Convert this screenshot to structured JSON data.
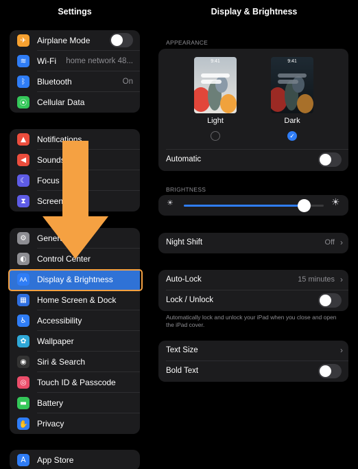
{
  "left": {
    "title": "Settings",
    "group1": [
      {
        "label": "Airplane Mode",
        "icon": "airplane-icon",
        "color": "#f7a130"
      },
      {
        "label": "Wi-Fi",
        "value": "home network 48...",
        "icon": "wifi-icon",
        "color": "#2f7df6"
      },
      {
        "label": "Bluetooth",
        "value": "On",
        "icon": "bluetooth-icon",
        "color": "#2f7df6"
      },
      {
        "label": "Cellular Data",
        "icon": "cellular-icon",
        "color": "#34c759"
      }
    ],
    "group2": [
      {
        "label": "Notifications",
        "icon": "notifications-icon",
        "color": "#eb4d3d"
      },
      {
        "label": "Sounds",
        "icon": "sounds-icon",
        "color": "#eb4d3d"
      },
      {
        "label": "Focus",
        "icon": "focus-icon",
        "color": "#5e5ce6"
      },
      {
        "label": "Screen Time",
        "icon": "hourglass-icon",
        "color": "#5e5ce6"
      }
    ],
    "group3": [
      {
        "label": "General",
        "icon": "gear-icon",
        "color": "#8e8e93"
      },
      {
        "label": "Control Center",
        "icon": "control-center-icon",
        "color": "#8e8e93"
      },
      {
        "label": "Display & Brightness",
        "icon": "display-icon",
        "color": "#2f7df6",
        "selected": true
      },
      {
        "label": "Home Screen & Dock",
        "icon": "home-screen-icon",
        "color": "#2f6fe0"
      },
      {
        "label": "Accessibility",
        "icon": "accessibility-icon",
        "color": "#2f7df6"
      },
      {
        "label": "Wallpaper",
        "icon": "wallpaper-icon",
        "color": "#2fa8d8"
      },
      {
        "label": "Siri & Search",
        "icon": "siri-icon",
        "color": "#333333"
      },
      {
        "label": "Touch ID & Passcode",
        "icon": "fingerprint-icon",
        "color": "#eb4d6a"
      },
      {
        "label": "Battery",
        "icon": "battery-icon",
        "color": "#34c759"
      },
      {
        "label": "Privacy",
        "icon": "hand-icon",
        "color": "#2f7df6"
      }
    ],
    "group4": [
      {
        "label": "App Store",
        "icon": "app-store-icon",
        "color": "#2f7df6"
      }
    ],
    "icon_glyphs": {
      "airplane-icon": "✈",
      "wifi-icon": "≋",
      "bluetooth-icon": "ᛒ",
      "cellular-icon": "⦿",
      "notifications-icon": "▲",
      "sounds-icon": "◀",
      "focus-icon": "☾",
      "hourglass-icon": "⧗",
      "gear-icon": "⚙",
      "control-center-icon": "◐",
      "display-icon": "AA",
      "home-screen-icon": "▦",
      "accessibility-icon": "♿",
      "wallpaper-icon": "✿",
      "siri-icon": "◉",
      "fingerprint-icon": "◎",
      "battery-icon": "▬",
      "hand-icon": "✋",
      "app-store-icon": "A"
    }
  },
  "right": {
    "title": "Display & Brightness",
    "appearance": {
      "section": "APPEARANCE",
      "preview_time": "9:41",
      "light_label": "Light",
      "dark_label": "Dark",
      "selected": "Dark",
      "automatic_label": "Automatic"
    },
    "brightness": {
      "section": "BRIGHTNESS",
      "level": 0.86
    },
    "night_shift": {
      "label": "Night Shift",
      "value": "Off"
    },
    "auto_lock": {
      "label": "Auto-Lock",
      "value": "15 minutes"
    },
    "lock_unlock": {
      "label": "Lock / Unlock"
    },
    "footnote": "Automatically lock and unlock your iPad when you close and open the iPad cover.",
    "text_size": {
      "label": "Text Size"
    },
    "bold_text": {
      "label": "Bold Text"
    }
  },
  "colors": {
    "highlight": "#f5a142",
    "arrow": "#f5a142",
    "accent": "#2f7df6"
  }
}
